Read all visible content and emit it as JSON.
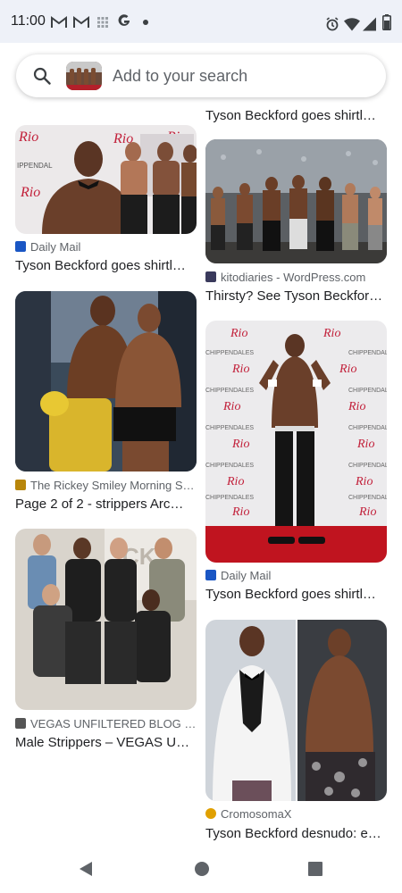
{
  "status_bar": {
    "time": "11:00",
    "left_icons": [
      "gmail-icon",
      "gmail-icon",
      "app-grid-icon",
      "google-icon",
      "dot-icon"
    ],
    "right_icons": [
      "alarm-icon",
      "wifi-icon",
      "signal-icon",
      "battery-icon"
    ]
  },
  "search": {
    "placeholder": "Add to your search",
    "icon": "search-icon"
  },
  "results": [
    {
      "source": "",
      "title": "Tyson Beckford goes shirtl…"
    },
    {
      "source": "Daily Mail",
      "title": "Tyson Beckford goes shirtl…",
      "source_color": "#1a56c4"
    },
    {
      "source": "kitodiaries - WordPress.com",
      "title": "Thirsty? See Tyson Beckfor…",
      "source_color": "#3a3a5c"
    },
    {
      "source": "The Rickey Smiley Morning S…",
      "title": "Page 2 of 2 - strippers Arc…",
      "source_color": "#b8860b"
    },
    {
      "source": "Daily Mail",
      "title": "Tyson Beckford goes shirtl…",
      "source_color": "#1a56c4"
    },
    {
      "source": "VEGAS UNFILTERED BLOG b…",
      "title": "Male Strippers – VEGAS U…",
      "source_color": "#555555"
    },
    {
      "source": "CromosomaX",
      "title": "Tyson Beckford desnudo: e…",
      "source_color": "#e0a000"
    }
  ],
  "nav_bar": {
    "back": "back-icon",
    "home": "home-icon",
    "recents": "recents-icon"
  }
}
